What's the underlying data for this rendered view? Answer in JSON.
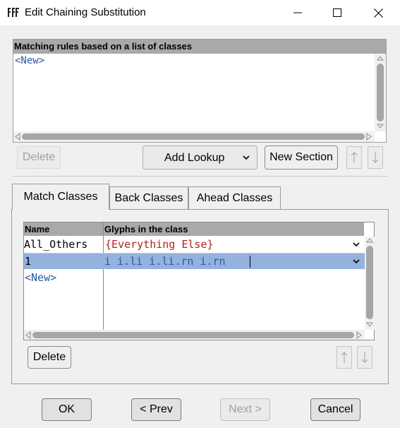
{
  "window": {
    "title": "Edit Chaining Substitution"
  },
  "rules": {
    "header": "Matching rules based on a list of classes",
    "items": [
      "<New>"
    ]
  },
  "toolbar": {
    "delete_label": "Delete",
    "add_lookup_label": "Add Lookup",
    "new_section_label": "New Section"
  },
  "tabs": [
    {
      "label": "Match Classes",
      "active": true
    },
    {
      "label": "Back Classes",
      "active": false
    },
    {
      "label": "Ahead Classes",
      "active": false
    }
  ],
  "classes_table": {
    "columns": [
      "Name",
      "Glyphs in the class"
    ],
    "rows": [
      {
        "name": "All_Others",
        "glyphs": "{Everything Else}",
        "selected": false
      },
      {
        "name": "1",
        "glyphs": "i i.li i.li.rn i.rn",
        "selected": true
      }
    ],
    "new_label": "<New>"
  },
  "classes_delete_label": "Delete",
  "footer": {
    "ok_label": "OK",
    "prev_label": "< Prev",
    "next_label": "Next >",
    "cancel_label": "Cancel"
  },
  "colors": {
    "new_text": "#2c5aa0",
    "everything_else_text": "#b22222",
    "selected_row": "#93b2de",
    "header_bg": "#a9a9a9"
  },
  "icons": {
    "app": "fontforge-icon",
    "minimize": "minimize-icon",
    "maximize": "maximize-icon",
    "close": "close-icon",
    "dropdown": "chevron-down-icon",
    "move_up": "arrow-up-icon",
    "move_down": "arrow-down-icon"
  }
}
